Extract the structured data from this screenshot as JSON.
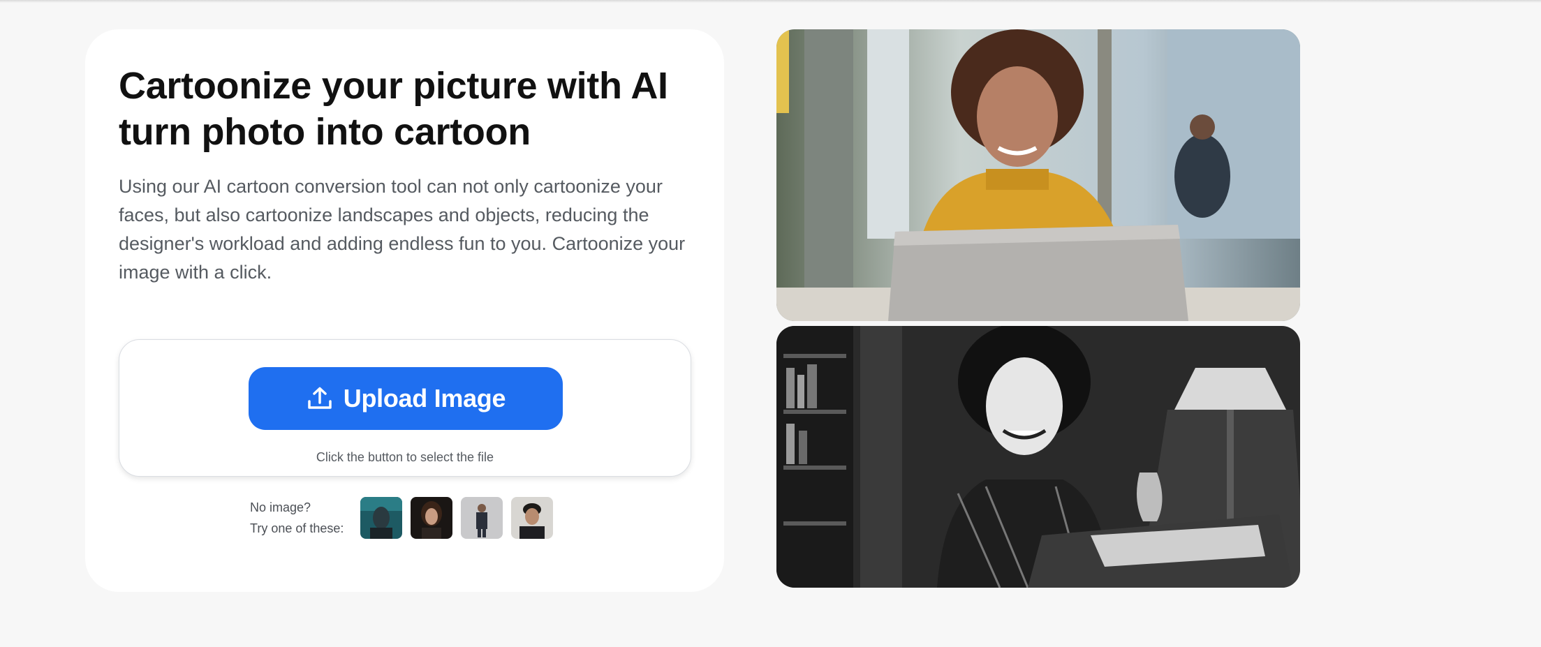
{
  "hero": {
    "title_line1": "Cartoonize your picture with AI",
    "title_line2": "turn photo into cartoon",
    "description": "Using our AI cartoon conversion tool can not only cartoonize your faces, but also cartoonize landscapes and objects, reducing the designer's workload and adding endless fun to you. Cartoonize your image with a click."
  },
  "upload": {
    "button_label": "Upload Image",
    "button_icon": "upload-icon",
    "hint": "Click the button to select the file",
    "accent_color": "#1f6ff0"
  },
  "samples": {
    "label_line1": "No image?",
    "label_line2": "Try one of these:",
    "items": [
      "sample-image-1",
      "sample-image-2",
      "sample-image-3",
      "sample-image-4"
    ]
  },
  "previews": {
    "original": "original-photo",
    "cartoon": "cartoon-result-photo"
  }
}
